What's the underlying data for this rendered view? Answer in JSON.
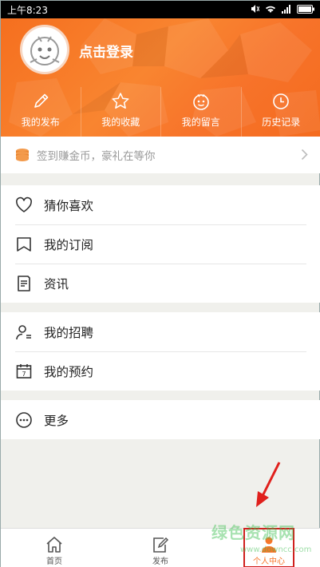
{
  "status_bar": {
    "time": "上午8:23"
  },
  "header": {
    "login_label": "点击登录",
    "shortcuts": [
      {
        "label": "我的发布",
        "icon": "pencil-icon"
      },
      {
        "label": "我的收藏",
        "icon": "star-icon"
      },
      {
        "label": "我的留言",
        "icon": "face-icon"
      },
      {
        "label": "历史记录",
        "icon": "clock-icon"
      }
    ]
  },
  "signin": {
    "label": "签到赚金币，豪礼在等你",
    "icon": "coins-icon"
  },
  "menu_group_1": [
    {
      "label": "猜你喜欢",
      "icon": "heart-icon"
    },
    {
      "label": "我的订阅",
      "icon": "bookmark-icon"
    },
    {
      "label": "资讯",
      "icon": "news-icon"
    }
  ],
  "menu_group_2": [
    {
      "label": "我的招聘",
      "icon": "person-list-icon"
    },
    {
      "label": "我的预约",
      "icon": "calendar-icon"
    }
  ],
  "menu_group_3": [
    {
      "label": "更多",
      "icon": "more-icon"
    }
  ],
  "bottom_nav": [
    {
      "label": "首页",
      "icon": "home-icon"
    },
    {
      "label": "发布",
      "icon": "compose-icon"
    },
    {
      "label": "个人中心",
      "icon": "person-icon"
    }
  ],
  "watermark": {
    "text": "绿色资源网",
    "url": "www.downcc.com"
  },
  "colors": {
    "accent": "#f7762a",
    "highlight": "#d0201e"
  }
}
